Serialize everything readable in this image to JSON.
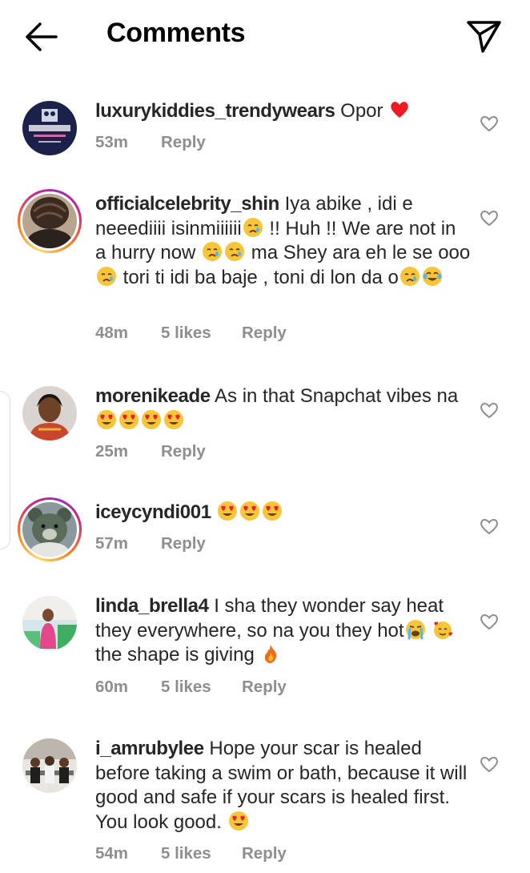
{
  "header": {
    "title": "Comments",
    "back_icon": "arrow-left-icon",
    "send_icon": "paper-plane-icon"
  },
  "comments": [
    {
      "username": "luxurykiddies_trendywears",
      "text": " Opor ",
      "time": "53m",
      "likes": "",
      "reply": "Reply",
      "avatar_caption": "Luxurykiddies_trendywears",
      "emojis_after": [
        "red-heart"
      ]
    },
    {
      "username": "officialcelebrity_shin",
      "text1": " Iya abike , idi e neeediiii isinmiiiiii",
      "text2": " !! Huh !! We are not in a hurry now ",
      "text3": " ma Shey ara eh le se ooo",
      "text4": " tori ti idi ba baje , toni di lon da o",
      "time": "48m",
      "likes": "5 likes",
      "reply": "Reply"
    },
    {
      "username": "morenikeade",
      "text": " As in that Snapchat vibes na ",
      "time": "25m",
      "reply": "Reply"
    },
    {
      "username": "iceycyndi001",
      "text": " ",
      "time": "57m",
      "reply": "Reply"
    },
    {
      "username": "linda_brella4",
      "text1": " I sha they wonder say heat they everywhere, so na you they hot",
      "text2": " the shape is giving ",
      "time": "60m",
      "likes": "5 likes",
      "reply": "Reply"
    },
    {
      "username": "i_amrubylee",
      "text": " Hope your scar is healed before taking a swim or bath, because it will good and safe if your scars is healed first. You look good. ",
      "time": "54m",
      "likes": "5 likes",
      "reply": "Reply"
    }
  ],
  "colors": {
    "text": "#262626",
    "meta": "#8e8e8e",
    "heart_red": "#ed1c24"
  }
}
